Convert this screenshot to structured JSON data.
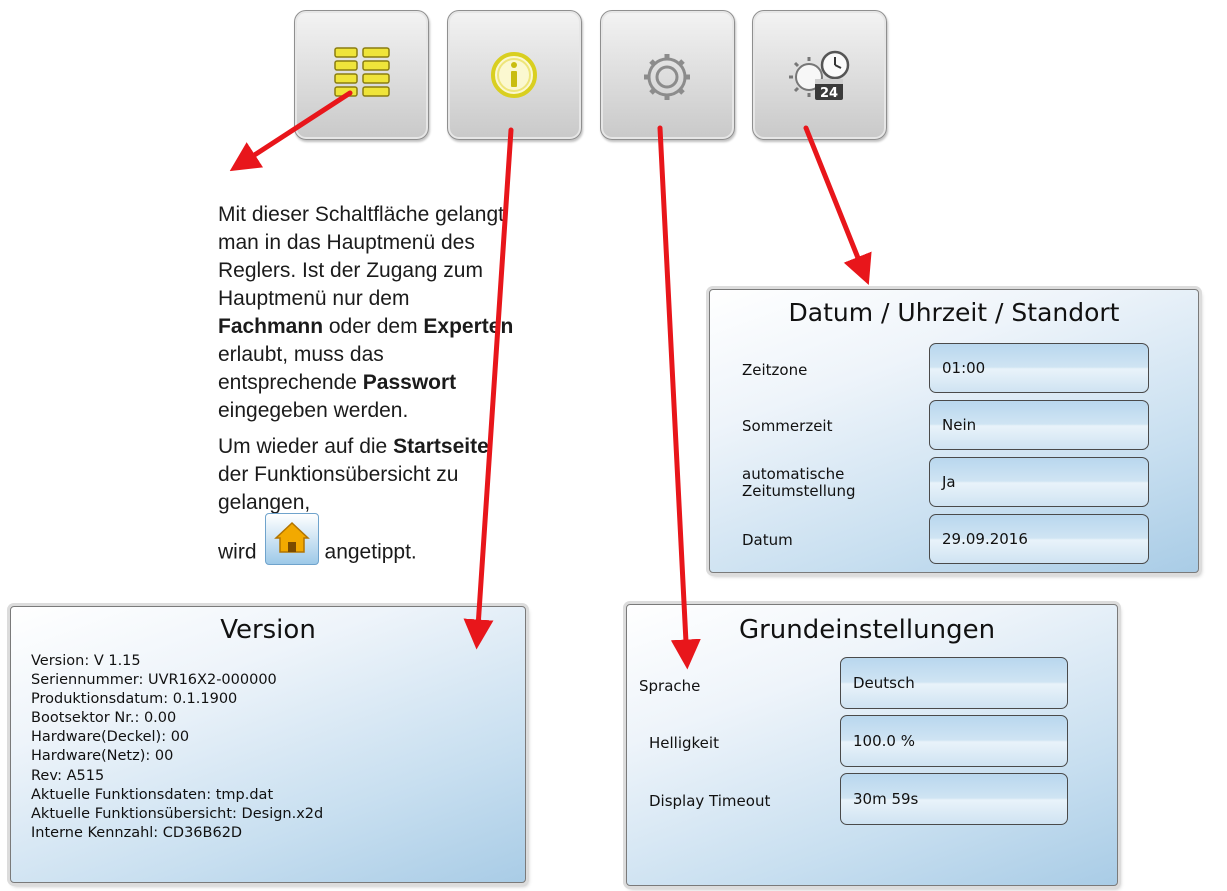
{
  "toolbar": {
    "buttons": [
      {
        "icon": "main-menu-grid-icon"
      },
      {
        "icon": "info-icon"
      },
      {
        "icon": "settings-gear-icon"
      },
      {
        "icon": "date-time-clock-icon",
        "badge": "24"
      }
    ]
  },
  "description": {
    "p1_a": "Mit dieser Schaltfläche gelangt man in das Hauptmenü des Reglers. Ist der Zugang zum Hauptmenü nur dem ",
    "p1_b": "Fachmann",
    "p1_c": " oder dem ",
    "p1_d": "Experten",
    "p1_e": " erlaubt, muss das entsprechende ",
    "p1_f": "Passwort",
    "p1_g": " eingegeben werden.",
    "p2_a": "Um wieder auf die ",
    "p2_b": "Startseite",
    "p2_c": " der Funktionsübersicht zu gelangen,",
    "p3_a": "wird",
    "p3_b": "angetippt.",
    "home_icon": "home-icon"
  },
  "datum_panel": {
    "title": "Datum / Uhrzeit / Standort",
    "rows": [
      {
        "label": "Zeitzone",
        "value": "01:00"
      },
      {
        "label": "Sommerzeit",
        "value": "Nein"
      },
      {
        "label": "automatische\nZeitumstellung",
        "value": "Ja"
      },
      {
        "label": "Datum",
        "value": "29.09.2016"
      }
    ]
  },
  "version_panel": {
    "title": "Version",
    "lines": [
      "Version: V 1.15",
      "Seriennummer: UVR16X2-000000",
      "Produktionsdatum: 0.1.1900",
      "Bootsektor Nr.: 0.00",
      "Hardware(Deckel): 00",
      "Hardware(Netz): 00",
      "Rev: A515",
      "Aktuelle Funktionsdaten: tmp.dat",
      "Aktuelle Funktionsübersicht: Design.x2d",
      "Interne Kennzahl: CD36B62D"
    ]
  },
  "grund_panel": {
    "title": "Grundeinstellungen",
    "rows": [
      {
        "label": "Sprache",
        "value": "Deutsch"
      },
      {
        "label": "Helligkeit",
        "value": "100.0 %"
      },
      {
        "label": "Display Timeout",
        "value": "30m 59s"
      }
    ]
  },
  "colors": {
    "arrow": "#e8161b",
    "panel_blue": "#a9cce6",
    "icon_yellow": "#f2e83a"
  }
}
